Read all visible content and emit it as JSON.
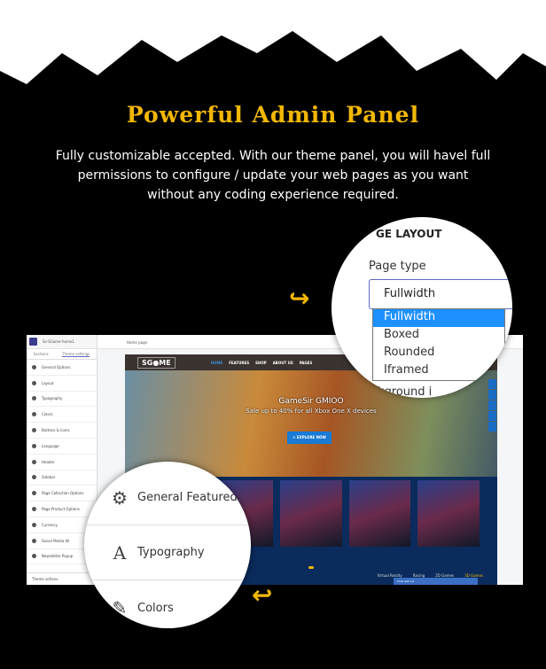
{
  "heading": "Powerful Admin Panel",
  "description": "Fully customizable  accepted. With our theme panel, you will havel full permissions to configure / update your web pages as you want without any coding experience required.",
  "colors": {
    "accent": "#f2b705",
    "selected_option": "#1e90ff",
    "background": "#000000"
  },
  "admin": {
    "store_name": "Ss-SGame-home1",
    "tabs": [
      "Sections",
      "Theme settings"
    ],
    "active_tab": "Theme settings",
    "sidebar_items": [
      "General Options",
      "Layout",
      "Typography",
      "Colors",
      "Buttons & Icons",
      "Language",
      "Header",
      "Sidebar",
      "Page Collection Options",
      "Page Product Options",
      "Currency",
      "Social Media All",
      "Newsletter Popup"
    ],
    "theme_actions": "Theme actions",
    "page_select": "Home page"
  },
  "preview": {
    "logo": "SG●ME",
    "menu": [
      "HOME",
      "FEATURES",
      "SHOP",
      "ABOUT US",
      "PAGES"
    ],
    "hero_title": "GameSir GMIOO",
    "hero_subtitle": "Sale up to 40% for all Xbox One X devices",
    "cta": "> EXPLORE NOW",
    "categories": [
      "Virtual Reality",
      "Racing",
      "2D Games",
      "3D Games"
    ],
    "chat": "Chat with Us"
  },
  "zoom_layout": {
    "section_title": "GE LAYOUT",
    "label": "Page type",
    "value": "Fullwidth",
    "options": [
      "Fullwidth",
      "Boxed",
      "Rounded",
      "Iframed"
    ],
    "selected": "Fullwidth",
    "cut_text": "kground i"
  },
  "zoom_sidebar": {
    "items": [
      "General Featured",
      "Typography",
      "Colors"
    ],
    "icons": [
      "gear-icon",
      "typography-icon",
      "colors-icon"
    ]
  }
}
